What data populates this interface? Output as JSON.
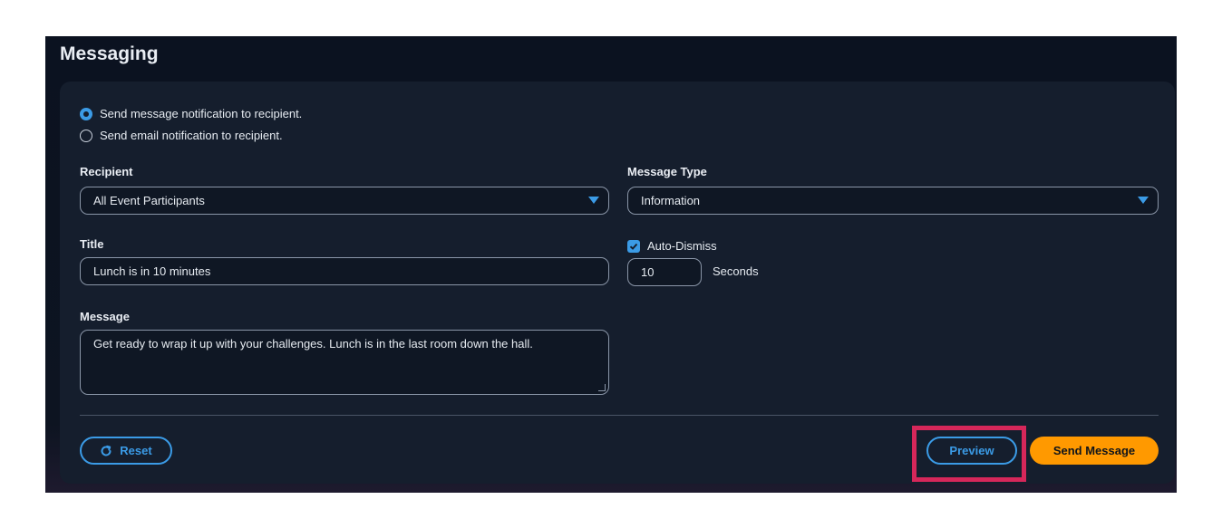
{
  "page": {
    "title": "Messaging"
  },
  "delivery": {
    "options": [
      {
        "label": "Send message notification to recipient.",
        "checked": true
      },
      {
        "label": "Send email notification to recipient.",
        "checked": false
      }
    ]
  },
  "recipient": {
    "label": "Recipient",
    "value": "All Event Participants"
  },
  "message_type": {
    "label": "Message Type",
    "value": "Information"
  },
  "title_field": {
    "label": "Title",
    "value": "Lunch is in 10 minutes"
  },
  "auto_dismiss": {
    "label": "Auto-Dismiss",
    "checked": true,
    "value": "10",
    "unit": "Seconds"
  },
  "message_field": {
    "label": "Message",
    "value": "Get ready to wrap it up with your challenges. Lunch is in the last room down the hall."
  },
  "actions": {
    "reset_label": "Reset",
    "preview_label": "Preview",
    "send_label": "Send Message"
  },
  "colors": {
    "accent": "#3b9be6",
    "primary_button": "#ff9900",
    "highlight": "#d6275a",
    "card_bg": "#151e2d"
  }
}
